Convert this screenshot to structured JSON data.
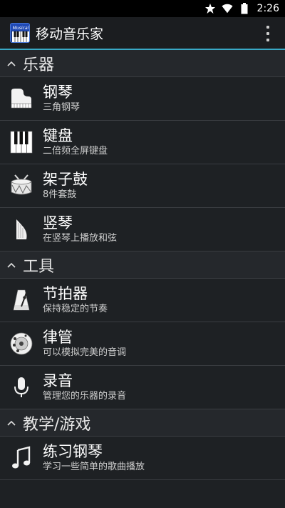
{
  "status_bar": {
    "time": "2:26",
    "icons": [
      "star-icon",
      "wifi-icon",
      "battery-icon"
    ]
  },
  "action_bar": {
    "app_icon_label": "Musical",
    "title": "移动音乐家",
    "overflow_icon": "overflow-menu-icon"
  },
  "sections": [
    {
      "title": "乐器",
      "items": [
        {
          "icon": "piano-icon",
          "name": "钢琴",
          "sub": "三角钢琴"
        },
        {
          "icon": "keyboard-icon",
          "name": "键盘",
          "sub": "二倍频全屏键盘"
        },
        {
          "icon": "drum-icon",
          "name": "架子鼓",
          "sub": "8件套鼓"
        },
        {
          "icon": "harp-icon",
          "name": "竖琴",
          "sub": "在竖琴上播放和弦"
        }
      ]
    },
    {
      "title": "工具",
      "items": [
        {
          "icon": "metronome-icon",
          "name": "节拍器",
          "sub": "保持稳定的节奏"
        },
        {
          "icon": "pitch-pipe-icon",
          "name": "律管",
          "sub": "可以模拟完美的音调"
        },
        {
          "icon": "microphone-icon",
          "name": "录音",
          "sub": "管理您的乐器的录音"
        }
      ]
    },
    {
      "title": "教学/游戏",
      "items": [
        {
          "icon": "music-note-icon",
          "name": "练习钢琴",
          "sub": "学习一些简单的歌曲播放"
        }
      ]
    }
  ],
  "colors": {
    "accent": "#39a9c6",
    "background": "#1e2124",
    "header_bg": "#25282c"
  }
}
